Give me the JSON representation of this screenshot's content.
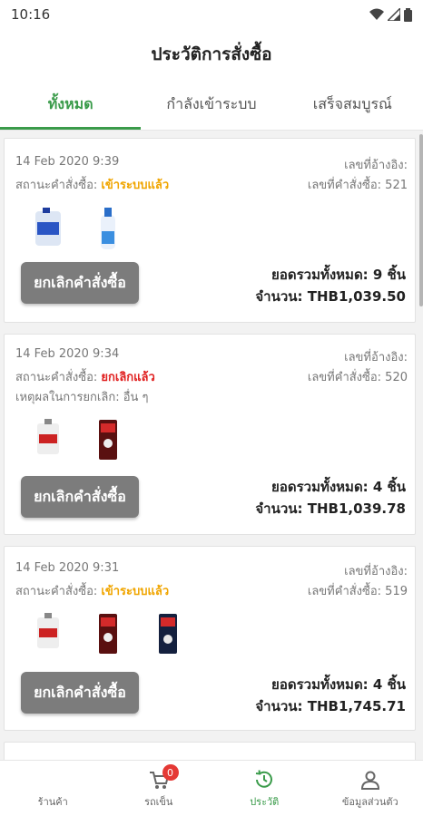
{
  "status_bar": {
    "time": "10:16"
  },
  "header": {
    "title": "ประวัติการสั่งซื้อ"
  },
  "tabs": [
    {
      "label": "ทั้งหมด",
      "active": true
    },
    {
      "label": "กำลังเข้าระบบ",
      "active": false
    },
    {
      "label": "เสร็จสมบูรณ์",
      "active": false
    }
  ],
  "orders": [
    {
      "date": "14 Feb 2020 9:39",
      "status_label": "สถานะคำสั่งซื้อ:",
      "status_value": "เข้าระบบแล้ว",
      "ref_label": "เลขที่อ้างอิง:",
      "order_no": "เลขที่คำสั่งซื้อ: 521",
      "cancel_label": "ยกเลิกคำสั่งซื้อ",
      "total_items": "ยอดรวมทั้งหมด:  9 ชิ้น",
      "amount": "จำนวน: THB1,039.50"
    },
    {
      "date": "14 Feb 2020 9:34",
      "status_label": "สถานะคำสั่งซื้อ:",
      "status_value": "ยกเลิกแล้ว",
      "ref_label": "เลขที่อ้างอิง:",
      "order_no": "เลขที่คำสั่งซื้อ: 520",
      "reason": "เหตุผลในการยกเลิก: อื่น ๆ",
      "cancel_label": "ยกเลิกคำสั่งซื้อ",
      "total_items": "ยอดรวมทั้งหมด:  4 ชิ้น",
      "amount": "จำนวน: THB1,039.78"
    },
    {
      "date": "14 Feb 2020 9:31",
      "status_label": "สถานะคำสั่งซื้อ:",
      "status_value": "เข้าระบบแล้ว",
      "ref_label": "เลขที่อ้างอิง:",
      "order_no": "เลขที่คำสั่งซื้อ: 519",
      "cancel_label": "ยกเลิกคำสั่งซื้อ",
      "total_items": "ยอดรวมทั้งหมด:  4 ชิ้น",
      "amount": "จำนวน: THB1,745.71"
    }
  ],
  "bottom_nav": [
    {
      "label": "ร้านค้า",
      "icon": "store-icon"
    },
    {
      "label": "รถเข็น",
      "icon": "cart-icon",
      "badge": "0"
    },
    {
      "label": "ประวัติ",
      "icon": "history-icon",
      "active": true
    },
    {
      "label": "ข้อมูลส่วนตัว",
      "icon": "person-icon"
    }
  ],
  "colors": {
    "accent": "#3a9b4a",
    "status_ok": "#f0a500",
    "status_cancel": "#e02020",
    "button": "#7c7c7c"
  }
}
